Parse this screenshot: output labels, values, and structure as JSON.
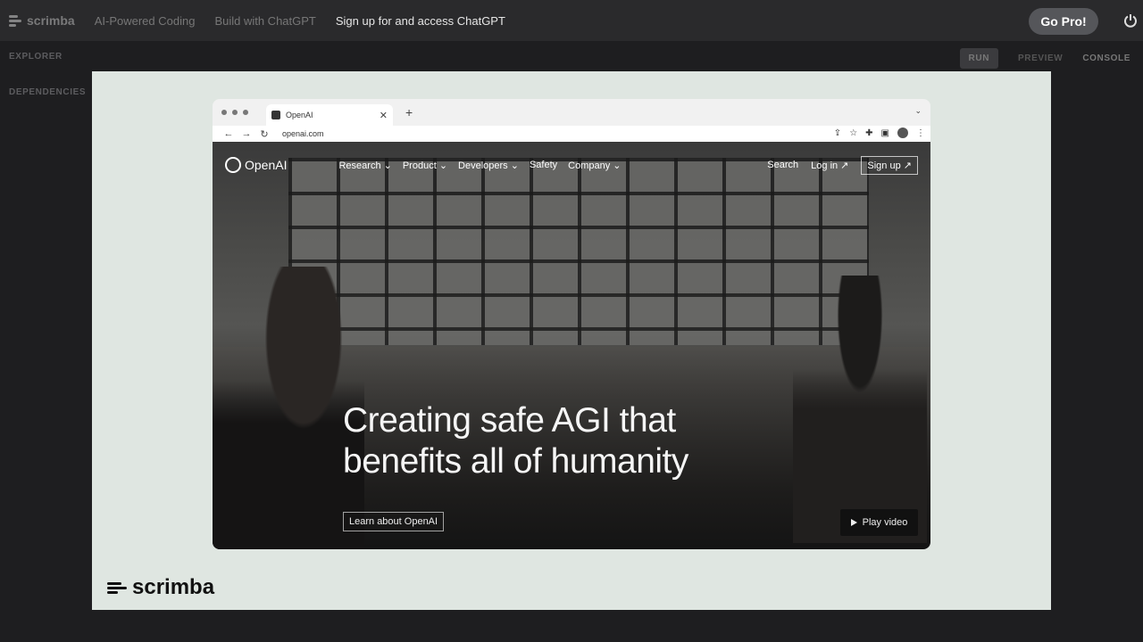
{
  "topbar": {
    "brand": "scrimba",
    "breadcrumbs": [
      "AI-Powered Coding",
      "Build with ChatGPT",
      "Sign up for and access ChatGPT"
    ],
    "go_pro": "Go Pro!"
  },
  "sidebar": {
    "explorer": "EXPLORER",
    "dependencies": "DEPENDENCIES"
  },
  "editor_tabs": {
    "run": "RUN",
    "preview": "PREVIEW",
    "console": "CONSOLE"
  },
  "browser": {
    "tab_title": "OpenAI",
    "url": "openai.com"
  },
  "site": {
    "logo": "OpenAI",
    "menu": [
      "Research",
      "Product",
      "Developers",
      "Safety",
      "Company"
    ],
    "search": "Search",
    "login": "Log in ↗",
    "signup": "Sign up ↗",
    "headline_1": "Creating safe AGI that",
    "headline_2": "benefits all of humanity",
    "learn": "Learn about OpenAI",
    "play": "Play video"
  },
  "footer_logo": "scrimba",
  "colors": {
    "frame_bg": "#dfe6e1",
    "app_bg": "#1e1e20"
  }
}
